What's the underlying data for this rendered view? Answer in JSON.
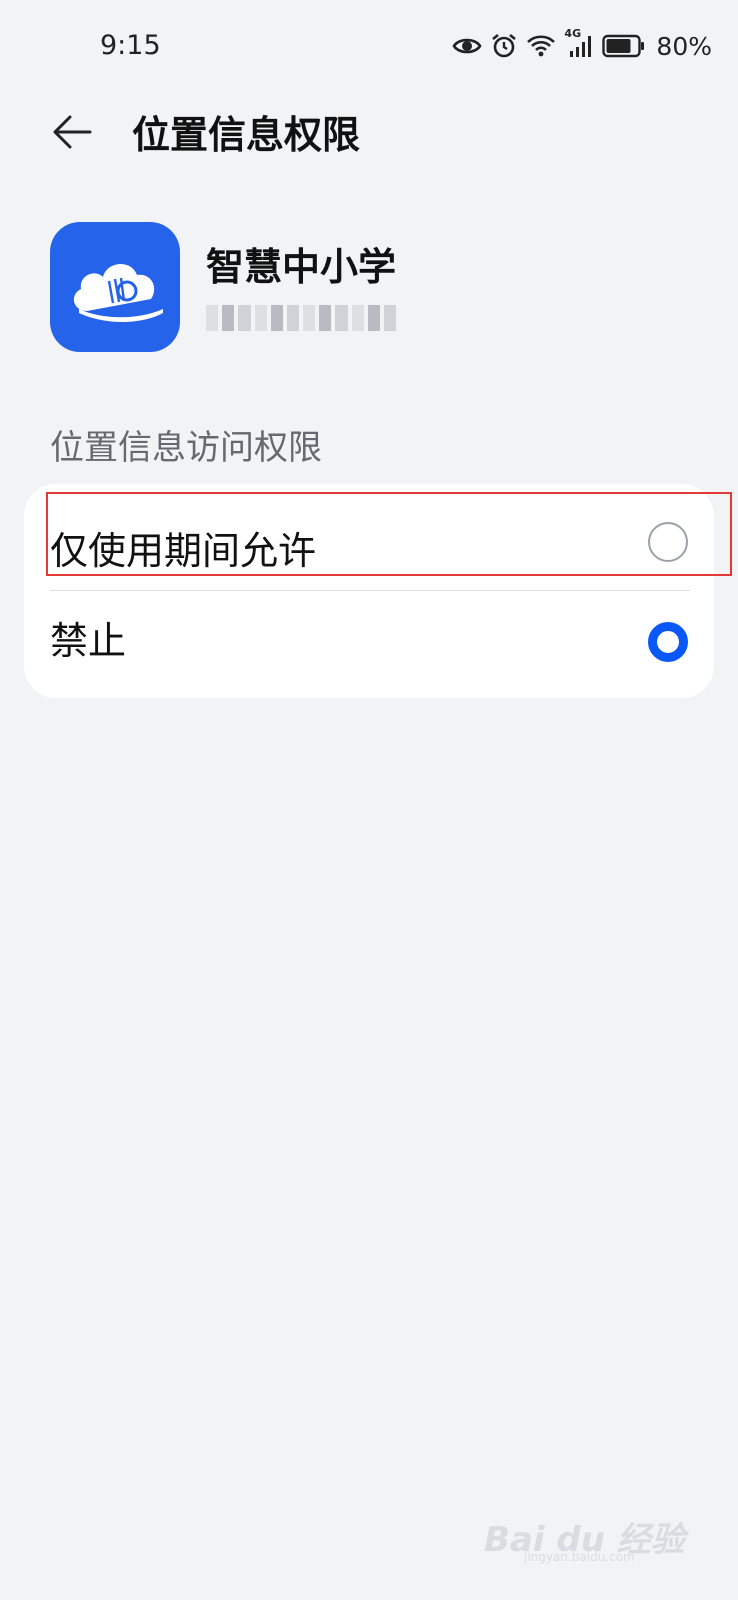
{
  "status_bar": {
    "time": "9:15",
    "network_label": "4G",
    "battery_percent": "80%",
    "battery_level": 0.8,
    "icons": [
      "eye-icon",
      "alarm-icon",
      "wifi-icon",
      "signal-icon",
      "battery-icon"
    ]
  },
  "header": {
    "back_icon": "arrow-left-icon",
    "title": "位置信息权限"
  },
  "app": {
    "name": "智慧中小学",
    "icon": "cloud-book-icon",
    "icon_color": "#2563eb"
  },
  "section": {
    "label": "位置信息访问权限"
  },
  "options": [
    {
      "label": "仅使用期间允许",
      "selected": false
    },
    {
      "label": "禁止",
      "selected": true
    }
  ],
  "colors": {
    "background": "#f1f3f5",
    "accent": "#0a59f7",
    "highlight": "#e53935"
  },
  "watermark": {
    "text": "Bai du 经验",
    "sub": "jingyan.baidu.com"
  }
}
